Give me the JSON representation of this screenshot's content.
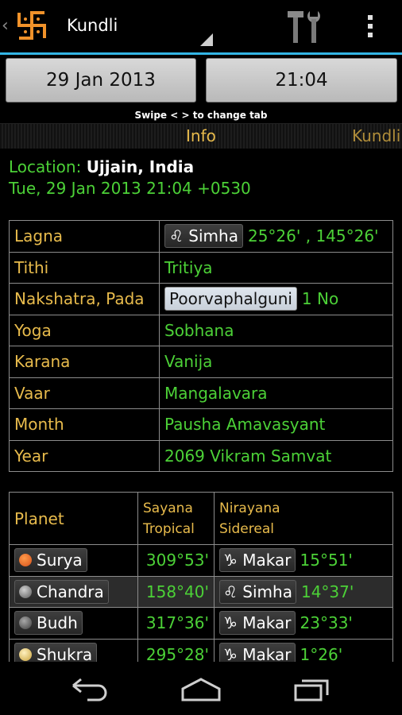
{
  "app": {
    "title": "Kundli"
  },
  "colors": {
    "accent_cyan": "#33b5e5",
    "label_gold": "#e8bb4c",
    "value_green": "#4cd137",
    "logo_orange": "#f0922a"
  },
  "icons": {
    "logo": "swastik-icon",
    "back": "chevron-left-icon",
    "tools": "tools-icon",
    "overflow": "overflow-menu-icon"
  },
  "controls": {
    "date": "29 Jan 2013",
    "time": "21:04"
  },
  "hint": "Swipe < > to change tab",
  "tabs": {
    "current": "Info",
    "next": "Kundli"
  },
  "location": {
    "label": "Location:",
    "value": "Ujjain, India"
  },
  "datetime": "Tue, 29 Jan 2013 21:04 +0530",
  "info_rows": [
    {
      "label": "Lagna",
      "chip": "Simha",
      "chip_symbol": "♌",
      "value": "25°26' , 145°26'"
    },
    {
      "label": "Tithi",
      "value": "Tritiya"
    },
    {
      "label": "Nakshatra, Pada",
      "chip": "Poorvaphalguni",
      "value": "1 No"
    },
    {
      "label": "Yoga",
      "value": "Sobhana"
    },
    {
      "label": "Karana",
      "value": "Vanija"
    },
    {
      "label": "Vaar",
      "value": "Mangalavara"
    },
    {
      "label": "Month",
      "value": "Pausha Amavasyant"
    },
    {
      "label": "Year",
      "value": "2069 Vikram Samvat"
    }
  ],
  "planet_table": {
    "headers": {
      "planet": "Planet",
      "sayana_1": "Sayana",
      "sayana_2": "Tropical",
      "nirayana_1": "Nirayana",
      "nirayana_2": "Sidereal"
    },
    "rows": [
      {
        "planet": "Surya",
        "color": "#e8641e",
        "sayana": "309°53'",
        "sign_symbol": "♑",
        "sign": "Makar",
        "nirayana": "15°51'"
      },
      {
        "planet": "Chandra",
        "color": "#9a9a9a",
        "sayana": "158°40'",
        "sign_symbol": "♌",
        "sign": "Simha",
        "nirayana": "14°37'"
      },
      {
        "planet": "Budh",
        "color": "#7a7a7a",
        "sayana": "317°36'",
        "sign_symbol": "♑",
        "sign": "Makar",
        "nirayana": "23°33'"
      },
      {
        "planet": "Shukra",
        "color": "#f2d37a",
        "sayana": "295°28'",
        "sign_symbol": "♑",
        "sign": "Makar",
        "nirayana": "1°26'"
      }
    ]
  }
}
